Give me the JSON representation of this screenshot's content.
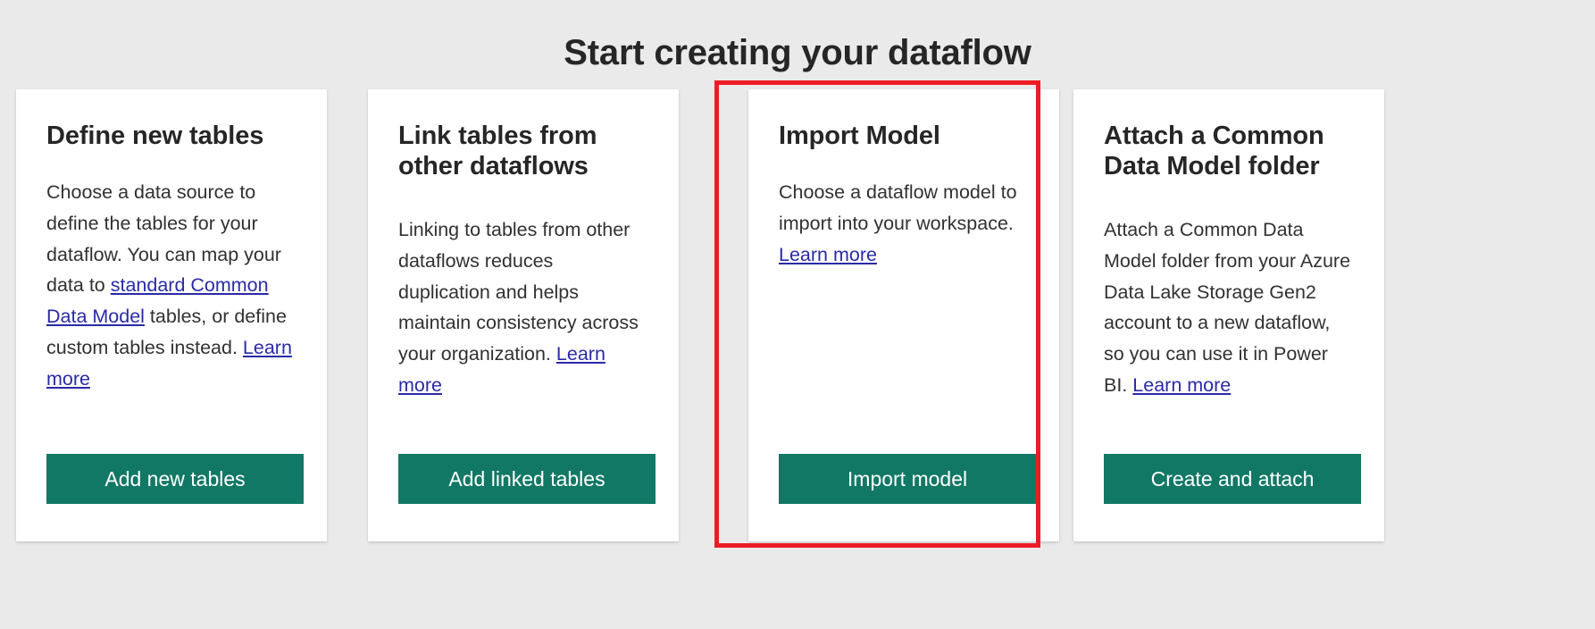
{
  "page": {
    "title": "Start creating your dataflow",
    "background_color": "#eaeaea",
    "accent_button_color": "#117865",
    "link_color": "#2a2aa8",
    "highlight_color": "#ed1c24"
  },
  "cards": [
    {
      "title": "Define new tables",
      "body_line_1": "Choose a data source to define the tables for your dataflow. You can map your data to ",
      "inline_link": "standard Common Data Model",
      "body_line_2": " tables, or define custom tables instead.",
      "learn_more": "Learn more",
      "button_label": "Add new tables",
      "highlighted": false
    },
    {
      "title": "Link tables from other dataflows",
      "body_line_1": "Linking to tables from other dataflows reduces duplication and helps maintain consistency across your organization.",
      "inline_link": "",
      "body_line_2": "",
      "learn_more": "Learn more",
      "button_label": "Add linked tables",
      "highlighted": false
    },
    {
      "title": "Import Model",
      "body_line_1": "Choose a dataflow model to import into your workspace.",
      "inline_link": "",
      "body_line_2": "",
      "learn_more": "Learn more",
      "button_label": "Import model",
      "highlighted": true
    },
    {
      "title": "Attach a Common Data Model folder",
      "body_line_1": "Attach a Common Data Model folder from your Azure Data Lake Storage Gen2 account to a new dataflow, so you can use it in Power BI.",
      "inline_link": "",
      "body_line_2": "",
      "learn_more": "Learn more",
      "button_label": "Create and attach",
      "highlighted": false
    }
  ]
}
